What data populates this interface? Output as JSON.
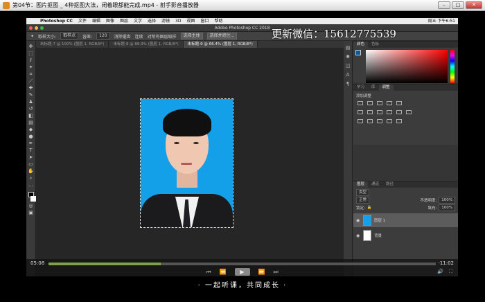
{
  "player": {
    "title": "第04节：图片抠图 _ 4种抠图大法，闭着眼都能完成.mp4 - 射手影音播放器",
    "minimize": "–",
    "maximize": "□",
    "close": "✕",
    "time_elapsed": "05:08",
    "time_remaining": "-11:02",
    "progress_percent": 29,
    "subtitle": "· 一起听课，共同成长 ·",
    "controls": [
      "⏮",
      "⏪",
      "▶",
      "⏩",
      "⏭"
    ]
  },
  "mac": {
    "app_menu": "Photoshop CC",
    "menus": [
      "文件",
      "编辑",
      "图像",
      "图层",
      "文字",
      "选择",
      "滤镜",
      "3D",
      "视图",
      "窗口",
      "帮助"
    ],
    "clock": "周五 下午6:51"
  },
  "photoshop": {
    "window_title": "Adobe Photoshop CC 2018",
    "options": {
      "sample_label": "取样大小:",
      "sample_value": "取样点",
      "tolerance_label": "容差:",
      "tolerance_value": "120",
      "antialias": "消除锯齿",
      "contiguous": "连续",
      "all_layers": "对所有图层取样",
      "subject_button": "选择主体",
      "mask_button": "选择并遮住..."
    },
    "tabs": [
      "未标题-7 @ 100% (图层 1, RGB/8*)",
      "未标题-8 @ 88.9% (图层 1, RGB/8*)",
      "未标题-9 @ 66.4% (图层 1, RGB/8*)"
    ],
    "active_tab_index": 2,
    "watermark": "更新微信：15612775539",
    "panels": {
      "color_tabs": [
        "颜色",
        "色板"
      ],
      "learn_tabs": [
        "学习",
        "库",
        "调整"
      ],
      "adjust_label": "添加调整",
      "layers_tabs": [
        "图层",
        "通道",
        "路径"
      ],
      "kind_label": "类型",
      "blend_mode": "正常",
      "opacity_label": "不透明度:",
      "opacity_value": "100%",
      "lock_label": "锁定:",
      "fill_label": "填充:",
      "fill_value": "100%",
      "layers": [
        {
          "name": "图层 1",
          "selected": true
        },
        {
          "name": "背景",
          "selected": false
        }
      ]
    }
  }
}
